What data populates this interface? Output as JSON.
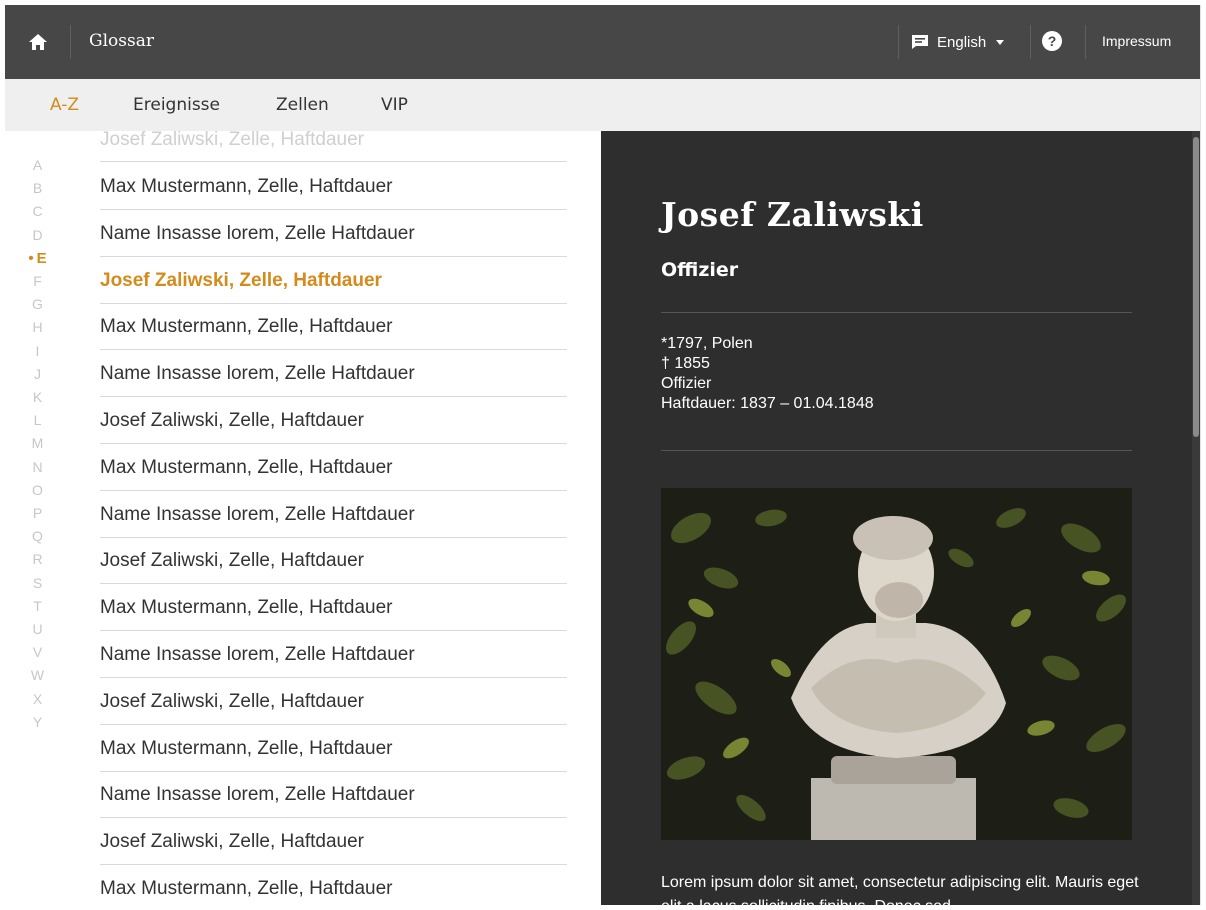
{
  "header": {
    "title": "Glossar",
    "language": "English",
    "help_label": "?",
    "impressum": "Impressum"
  },
  "tabs": [
    {
      "label": "A-Z",
      "active": true
    },
    {
      "label": "Ereignisse",
      "active": false
    },
    {
      "label": "Zellen",
      "active": false
    },
    {
      "label": "VIP",
      "active": false
    }
  ],
  "alphabet": [
    "A",
    "B",
    "C",
    "D",
    "E",
    "F",
    "G",
    "H",
    "I",
    "J",
    "K",
    "L",
    "M",
    "N",
    "O",
    "P",
    "Q",
    "R",
    "S",
    "T",
    "U",
    "V",
    "W",
    "X",
    "Y"
  ],
  "active_letter": "E",
  "entries": [
    {
      "label": "Josef Zaliwski, Zelle, Haftdauer",
      "state": "faded"
    },
    {
      "label": "Max Mustermann, Zelle, Haftdauer",
      "state": "normal"
    },
    {
      "label": "Name Insasse lorem, Zelle Haftdauer",
      "state": "normal"
    },
    {
      "label": "Josef Zaliwski, Zelle, Haftdauer",
      "state": "active"
    },
    {
      "label": "Max Mustermann, Zelle, Haftdauer",
      "state": "normal"
    },
    {
      "label": "Name Insasse lorem, Zelle Haftdauer",
      "state": "normal"
    },
    {
      "label": "Josef Zaliwski, Zelle, Haftdauer",
      "state": "normal"
    },
    {
      "label": "Max Mustermann, Zelle, Haftdauer",
      "state": "normal"
    },
    {
      "label": "Name Insasse lorem, Zelle Haftdauer",
      "state": "normal"
    },
    {
      "label": "Josef Zaliwski, Zelle, Haftdauer",
      "state": "normal"
    },
    {
      "label": "Max Mustermann, Zelle, Haftdauer",
      "state": "normal"
    },
    {
      "label": "Name Insasse lorem, Zelle Haftdauer",
      "state": "normal"
    },
    {
      "label": "Josef Zaliwski, Zelle, Haftdauer",
      "state": "normal"
    },
    {
      "label": "Max Mustermann, Zelle, Haftdauer",
      "state": "normal"
    },
    {
      "label": "Name Insasse lorem, Zelle Haftdauer",
      "state": "normal"
    },
    {
      "label": "Josef Zaliwski, Zelle, Haftdauer",
      "state": "normal"
    },
    {
      "label": "Max Mustermann, Zelle, Haftdauer",
      "state": "normal"
    }
  ],
  "detail": {
    "name": "Josef Zaliwski",
    "role": "Offizier",
    "born": "*1797, Polen",
    "died": "† 1855",
    "occupation": "Offizier",
    "term": "Haftdauer: 1837 – 01.04.1848",
    "description": "Lorem ipsum dolor sit amet, consectetur adipiscing elit. Mauris eget elit a lacus sollicitudin finibus. Donec sed"
  },
  "colors": {
    "topbar": "#474747",
    "tabbar": "#efefef",
    "accent": "#d48b1c",
    "detail_bg": "#2e2e2e"
  },
  "icons": {
    "home": "home-icon",
    "language": "chat-icon",
    "help": "help-icon"
  }
}
